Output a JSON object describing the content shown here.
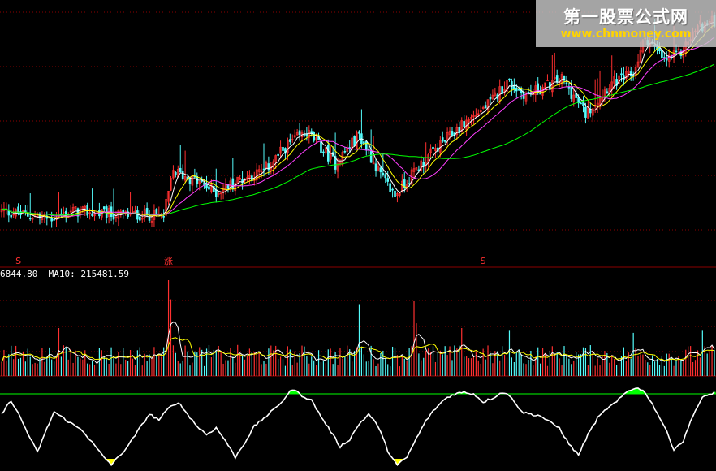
{
  "watermark": {
    "title": "第一股票公式网",
    "url": "www.chnmoney.com"
  },
  "volume_panel": {
    "label_text": "6844.80  MA10: 215481.59"
  },
  "signals": [
    {
      "label": "S",
      "color": "#ff3030",
      "index": 7
    },
    {
      "label": "涨",
      "color": "#ff3030",
      "index": 70
    },
    {
      "label": "S",
      "color": "#ff3030",
      "index": 202
    }
  ],
  "colors": {
    "background": "#000000",
    "grid": "#8b0000",
    "up": "#ff3030",
    "down": "#54fcfc",
    "ma_white": "#ffffff",
    "ma_yellow": "#ffff00",
    "ma_magenta": "#ff40ff",
    "ma_green": "#00ff00",
    "osc_upper": "#00ff00",
    "osc_lower": "#ffff00"
  },
  "chart_data": [
    {
      "type": "candlestick",
      "title": "",
      "x_count": 300,
      "price_path": [
        [
          0,
          9.6
        ],
        [
          10,
          9.3
        ],
        [
          20,
          9.0
        ],
        [
          30,
          9.6
        ],
        [
          40,
          9.4
        ],
        [
          50,
          9.3
        ],
        [
          60,
          9.3
        ],
        [
          68,
          9.2
        ],
        [
          72,
          12.6
        ],
        [
          80,
          12.0
        ],
        [
          90,
          11.0
        ],
        [
          100,
          12.0
        ],
        [
          110,
          12.6
        ],
        [
          120,
          14.6
        ],
        [
          128,
          15.6
        ],
        [
          140,
          13.2
        ],
        [
          150,
          15.4
        ],
        [
          160,
          12.0
        ],
        [
          165,
          10.8
        ],
        [
          175,
          13.0
        ],
        [
          185,
          14.8
        ],
        [
          195,
          16.4
        ],
        [
          205,
          17.8
        ],
        [
          212,
          19.4
        ],
        [
          220,
          18.4
        ],
        [
          235,
          19.6
        ],
        [
          245,
          17.0
        ],
        [
          255,
          19.2
        ],
        [
          265,
          20.0
        ],
        [
          270,
          22.8
        ],
        [
          278,
          21.0
        ],
        [
          285,
          21.6
        ],
        [
          292,
          23.6
        ],
        [
          299,
          24.0
        ]
      ],
      "ma_lines": [
        {
          "name": "MA5",
          "color": "#ffffff",
          "period": 5
        },
        {
          "name": "MA10",
          "color": "#ffff00",
          "period": 10
        },
        {
          "name": "MA20",
          "color": "#ff40ff",
          "period": 20
        },
        {
          "name": "MA60",
          "color": "#00ff00",
          "period": 60
        }
      ],
      "ylim": [
        6.0,
        25.0
      ]
    },
    {
      "type": "bar",
      "title": "",
      "series_name": "volume",
      "base_level": 0.25,
      "spikes": [
        {
          "index": 24,
          "value": 0.5
        },
        {
          "index": 70,
          "value": 1.0
        },
        {
          "index": 71,
          "value": 0.8
        },
        {
          "index": 150,
          "value": 0.75
        },
        {
          "index": 173,
          "value": 0.78
        },
        {
          "index": 174,
          "value": 0.55
        },
        {
          "index": 193,
          "value": 0.5
        },
        {
          "index": 213,
          "value": 0.48
        },
        {
          "index": 265,
          "value": 0.45
        },
        {
          "index": 294,
          "value": 0.48
        }
      ],
      "ma_lines": [
        {
          "name": "MA5",
          "color": "#ffffff"
        },
        {
          "name": "MA10",
          "color": "#ffff00"
        }
      ],
      "ylim": [
        0,
        1.0
      ]
    },
    {
      "type": "line",
      "title": "",
      "series_name": "oscillator",
      "upper_threshold": 0.8,
      "lower_threshold": 0.0,
      "points": [
        [
          0,
          0.55
        ],
        [
          4,
          0.72
        ],
        [
          8,
          0.5
        ],
        [
          12,
          0.25
        ],
        [
          15,
          0.08
        ],
        [
          18,
          0.3
        ],
        [
          22,
          0.58
        ],
        [
          26,
          0.5
        ],
        [
          30,
          0.42
        ],
        [
          34,
          0.35
        ],
        [
          38,
          0.2
        ],
        [
          42,
          0.05
        ],
        [
          46,
          -0.07
        ],
        [
          50,
          0.05
        ],
        [
          54,
          0.2
        ],
        [
          58,
          0.38
        ],
        [
          62,
          0.55
        ],
        [
          66,
          0.48
        ],
        [
          70,
          0.62
        ],
        [
          74,
          0.7
        ],
        [
          78,
          0.55
        ],
        [
          82,
          0.4
        ],
        [
          86,
          0.3
        ],
        [
          90,
          0.38
        ],
        [
          94,
          0.22
        ],
        [
          98,
          0.02
        ],
        [
          102,
          0.2
        ],
        [
          106,
          0.4
        ],
        [
          110,
          0.5
        ],
        [
          114,
          0.6
        ],
        [
          118,
          0.72
        ],
        [
          122,
          0.86
        ],
        [
          126,
          0.78
        ],
        [
          130,
          0.72
        ],
        [
          134,
          0.52
        ],
        [
          138,
          0.34
        ],
        [
          142,
          0.15
        ],
        [
          146,
          0.24
        ],
        [
          150,
          0.43
        ],
        [
          154,
          0.55
        ],
        [
          158,
          0.4
        ],
        [
          162,
          0.1
        ],
        [
          166,
          -0.08
        ],
        [
          170,
          0.02
        ],
        [
          174,
          0.25
        ],
        [
          178,
          0.47
        ],
        [
          182,
          0.62
        ],
        [
          186,
          0.74
        ],
        [
          190,
          0.8
        ],
        [
          194,
          0.82
        ],
        [
          198,
          0.8
        ],
        [
          202,
          0.7
        ],
        [
          206,
          0.75
        ],
        [
          210,
          0.82
        ],
        [
          214,
          0.76
        ],
        [
          218,
          0.58
        ],
        [
          222,
          0.55
        ],
        [
          226,
          0.53
        ],
        [
          230,
          0.45
        ],
        [
          234,
          0.38
        ],
        [
          238,
          0.18
        ],
        [
          242,
          0.05
        ],
        [
          246,
          0.3
        ],
        [
          250,
          0.5
        ],
        [
          254,
          0.62
        ],
        [
          258,
          0.7
        ],
        [
          262,
          0.82
        ],
        [
          266,
          0.88
        ],
        [
          270,
          0.82
        ],
        [
          274,
          0.62
        ],
        [
          278,
          0.4
        ],
        [
          282,
          0.12
        ],
        [
          286,
          0.22
        ],
        [
          290,
          0.54
        ],
        [
          294,
          0.75
        ],
        [
          299,
          0.82
        ]
      ],
      "ylim": [
        -0.15,
        1.0
      ]
    }
  ]
}
